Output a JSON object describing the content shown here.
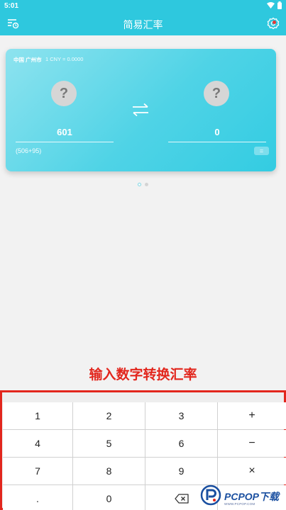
{
  "status_bar": {
    "time": "5:01"
  },
  "app_bar": {
    "title": "简易汇率"
  },
  "converter": {
    "region": "中国 广州市",
    "rate_text": "1 CNY = 0.0000",
    "left": {
      "symbol": "?",
      "amount": "601",
      "expression": "(506+95)"
    },
    "right": {
      "symbol": "?",
      "amount": "0"
    },
    "equals_label": "="
  },
  "pager": {
    "pages": 2,
    "active": 0
  },
  "caption": "输入数字转换汇率",
  "keypad": {
    "keys": [
      [
        "1",
        "2",
        "3",
        "+"
      ],
      [
        "4",
        "5",
        "6",
        "−"
      ],
      [
        "7",
        "8",
        "9",
        "×"
      ],
      [
        ".",
        "0",
        "⌫",
        ""
      ]
    ]
  },
  "watermark": {
    "brand": "PCPOP下载",
    "url": "WWW.PCPOP.COM"
  }
}
